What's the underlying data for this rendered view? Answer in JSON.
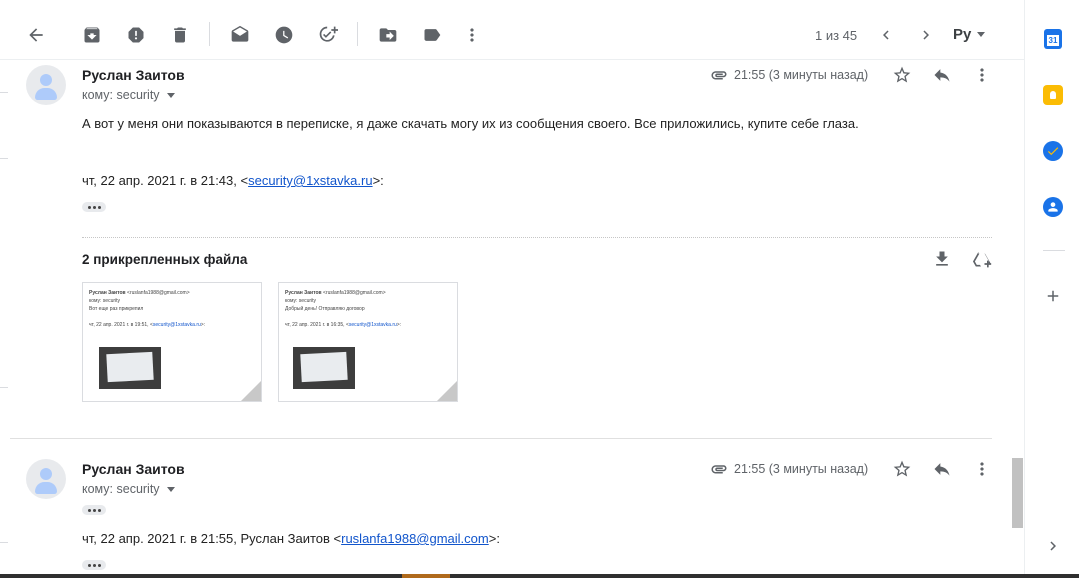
{
  "toolbar": {
    "back": "back-arrow-icon",
    "archive": "archive-icon",
    "spam": "report-spam-icon",
    "delete": "delete-icon",
    "mark_unread": "mark-unread-icon",
    "snooze": "snooze-icon",
    "add_task": "add-task-icon",
    "move": "move-to-icon",
    "label": "label-icon",
    "more": "more-vert-icon",
    "pager_text": "1 из 45",
    "lang": "Ру"
  },
  "messages": [
    {
      "sender": "Руслан Заитов",
      "to": "кому: security",
      "time": "21:55 (3 минуты назад)",
      "body": "А вот у меня они показываются в переписке, я даже скачать могу их из сообщения своего. Все приложились, купите себе глаза.",
      "quote_prefix": "чт, 22 апр. 2021 г. в 21:43, <",
      "quote_email": "security@1xstavka.ru",
      "quote_suffix": ">:",
      "attachments_title": "2 прикрепленных файла",
      "attachments": [
        {
          "from": "Руслан Заитов",
          "from_email": "<ruslanfa1988@gmail.com>",
          "to": "кому: security",
          "text": "Вот еще раз прикрепил",
          "quote": "чт, 22 апр. 2021 г. в 19:51, <",
          "quote_email": "security@1xstavka.ru",
          "quote_end": ">:"
        },
        {
          "from": "Руслан Заитов",
          "from_email": "<ruslanfa1988@gmail.com>",
          "to": "кому: security",
          "text": "Добрый день! Отправляю договор",
          "quote": "чт, 22 апр. 2021 г. в 16:35, <",
          "quote_email": "security@1xstavka.ru",
          "quote_end": ">:"
        }
      ]
    },
    {
      "sender": "Руслан Заитов",
      "to": "кому: security",
      "time": "21:55 (3 минуты назад)",
      "quote_prefix": "чт, 22 апр. 2021 г. в 21:55, Руслан Заитов <",
      "quote_email": "ruslanfa1988@gmail.com",
      "quote_suffix": ">:"
    }
  ],
  "sidepanel": {
    "calendar_day": "31"
  },
  "colors": {
    "calendar": "#1a73e8",
    "keep": "#fbbc04",
    "tasks": "#1a73e8",
    "contacts": "#1a73e8",
    "link": "#1155cc"
  }
}
